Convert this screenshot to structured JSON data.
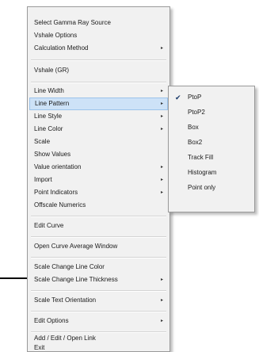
{
  "menu": {
    "items": [
      {
        "label": "Select Gamma Ray Source"
      },
      {
        "label": "Vshale Options"
      },
      {
        "label": "Calculation Method",
        "arrow": "▸"
      },
      {
        "label": "Vshale (GR)"
      },
      {
        "label": "Line Width",
        "arrow": "▸"
      },
      {
        "label": "Line Pattern",
        "arrow": "▸"
      },
      {
        "label": "Line Style",
        "arrow": "▸"
      },
      {
        "label": "Line Color",
        "arrow": "▸"
      },
      {
        "label": "Scale"
      },
      {
        "label": "Show Values"
      },
      {
        "label": "Value orientation",
        "arrow": "▸"
      },
      {
        "label": "Import",
        "arrow": "▸"
      },
      {
        "label": "Point Indicators",
        "arrow": "▸"
      },
      {
        "label": "Offscale Numerics"
      },
      {
        "label": "Edit Curve"
      },
      {
        "label": "Open Curve Average Window"
      },
      {
        "label": "Scale Change Line Color"
      },
      {
        "label": "Scale Change Line Thickness",
        "arrow": "▸"
      },
      {
        "label": "Scale Text Orientation",
        "arrow": "▸"
      },
      {
        "label": "Edit Options",
        "arrow": "▸"
      },
      {
        "label": "Add / Edit / Open Link"
      },
      {
        "label": "Exit"
      }
    ]
  },
  "submenu": {
    "check_mark": "✔",
    "items": [
      {
        "label": "PtoP"
      },
      {
        "label": "PtoP2"
      },
      {
        "label": "Box"
      },
      {
        "label": "Box2"
      },
      {
        "label": "Track Fill"
      },
      {
        "label": "Histogram"
      },
      {
        "label": "Point only"
      }
    ]
  },
  "colors": {
    "menu_background": "#f1f1f1",
    "highlight_background": "#cde2f7",
    "highlight_border": "#9cc3ea"
  }
}
